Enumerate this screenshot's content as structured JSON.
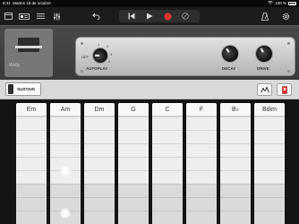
{
  "status_bar": {
    "time": "8:41",
    "date": "Martes 18 de octubre",
    "battery": "100 %"
  },
  "toolbar": {
    "icons": [
      "browser-icon",
      "tracks-view-icon",
      "mixer-icon",
      "undo-icon",
      "go-to-beginning-icon",
      "play-icon",
      "record-icon",
      "metronome-icon",
      "settings-icon",
      "tempo-icon"
    ]
  },
  "instrument": {
    "name": "Wolly",
    "autoplay_label": "AUTOPLAY",
    "autoplay_off": "OFF",
    "autoplay_positions": [
      "1",
      "2",
      "3",
      "4"
    ],
    "decay_label": "DECAY",
    "drive_label": "DRIVE"
  },
  "controls": {
    "sustain_label": "SUSTAIN"
  },
  "chords": [
    "Em",
    "Am",
    "Dm",
    "G",
    "C",
    "F",
    "B♭",
    "Bdim"
  ],
  "colors": {
    "record": "#e0342c",
    "panel": "#3f3f3f",
    "strip": "#f3f3f3"
  }
}
